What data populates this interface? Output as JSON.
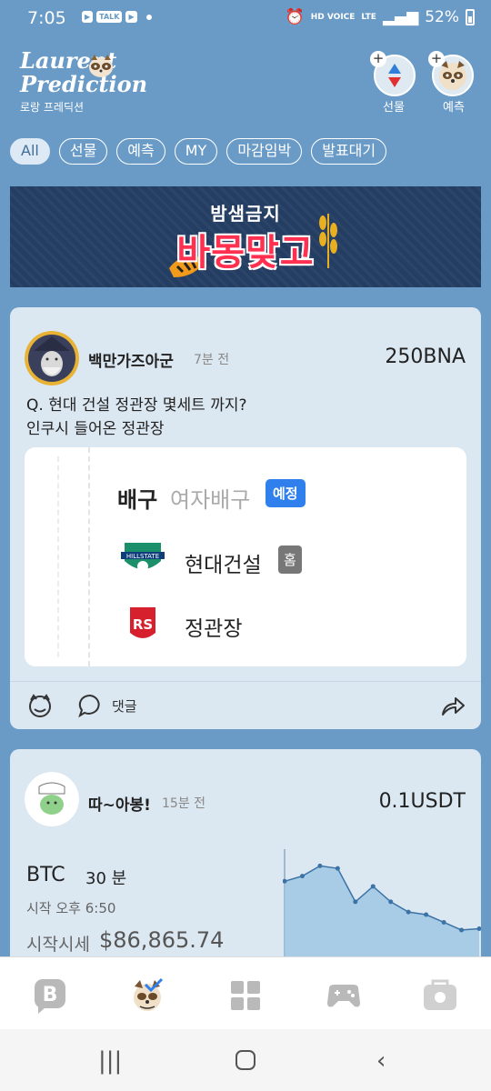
{
  "status_bar": {
    "time": "7:05",
    "app_icons": [
      "▶",
      "TALK",
      "▶"
    ],
    "network": "HD VOICE",
    "lte": "LTE",
    "battery": "52%"
  },
  "header": {
    "logo_line1": "Laurent",
    "logo_line2": "Prediction",
    "logo_sub": "로랑 프레딕션",
    "futures_label": "선물",
    "prediction_label": "예측"
  },
  "filters": [
    "All",
    "선물",
    "예측",
    "MY",
    "마감임박",
    "발표대기"
  ],
  "banner": {
    "line1": "밤샘금지",
    "line2": "바몽맞고"
  },
  "posts": [
    {
      "username": "백만가즈아군",
      "time": "7분 전",
      "reward": "250BNA",
      "question_line1": "Q. 현대 건설 정관장 몇세트 까지?",
      "question_line2": "인쿠시 들어온 정관장",
      "match": {
        "sport": "배구",
        "league": "여자배구",
        "status": "예정",
        "home_team": "현대건설",
        "home_badge": "홈",
        "away_team": "정관장"
      },
      "comment_label": "댓글"
    },
    {
      "username": "따~아봉!",
      "time": "15분 전",
      "reward": "0.1USDT",
      "asset": "BTC",
      "duration": "30 분",
      "start_time": "시작 오후 6:50",
      "start_price_label": "시작시세",
      "start_price": "$86,865.74",
      "chart_data": {
        "type": "area",
        "values": [
          100,
          104,
          112,
          110,
          84,
          96,
          84,
          76,
          74,
          68,
          62,
          63
        ],
        "color": "#9cc6e4"
      }
    }
  ],
  "colors": {
    "background": "#6a9bc7",
    "card": "#dbe7f1",
    "accent_blue": "#2f80ed",
    "banner": "#243e63",
    "banner_red": "#ff3050"
  }
}
